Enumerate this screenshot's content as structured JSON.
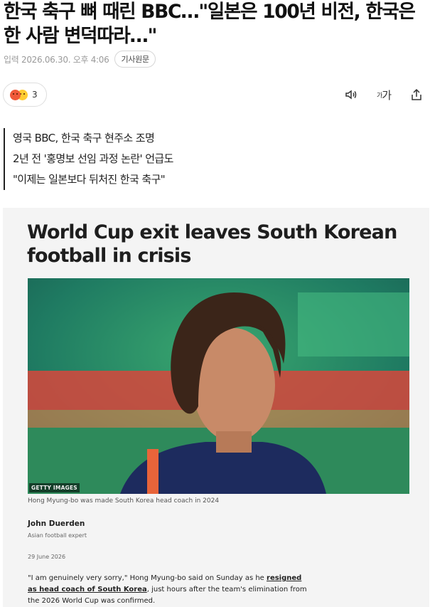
{
  "article": {
    "headline": "한국 축구 뼈 때린 BBC…\"일본은 100년 비전, 한국은 한 사람 변덕따라…\"",
    "meta_date": "입력 2026.06.30. 오후 4:06",
    "original_button": "기사원문"
  },
  "reactions": {
    "count": "3",
    "emotions": [
      "angry-emoji",
      "sad-emoji"
    ],
    "colors": {
      "angry": "#f05a3a",
      "sad": "#ffcc33"
    }
  },
  "toolbar": {
    "tts_icon": "speaker-icon",
    "font_label_small": "가",
    "font_label_large": "가",
    "share_icon": "share-icon"
  },
  "summary": {
    "lines": [
      "영국 BBC, 한국 축구 현주소 조명",
      "2년 전 '홍명보 선임 과정 논란' 언급도",
      "\"이제는 일본보다 뒤처진 한국 축구\""
    ]
  },
  "clip": {
    "title": "World Cup exit leaves South Korean football in crisis",
    "photo_credit": "GETTY IMAGES",
    "caption": "Hong Myung-bo was made South Korea head coach in 2024",
    "author": "John Duerden",
    "author_role": "Asian football expert",
    "date": "29 June 2026",
    "body_part1": "\"I am genuinely very sorry,\" Hong Myung-bo said on Sunday as he ",
    "body_link": "resigned as head coach of South Korea",
    "body_part2": ", just hours after the team's elimination from the 2026 World Cup was confirmed."
  }
}
